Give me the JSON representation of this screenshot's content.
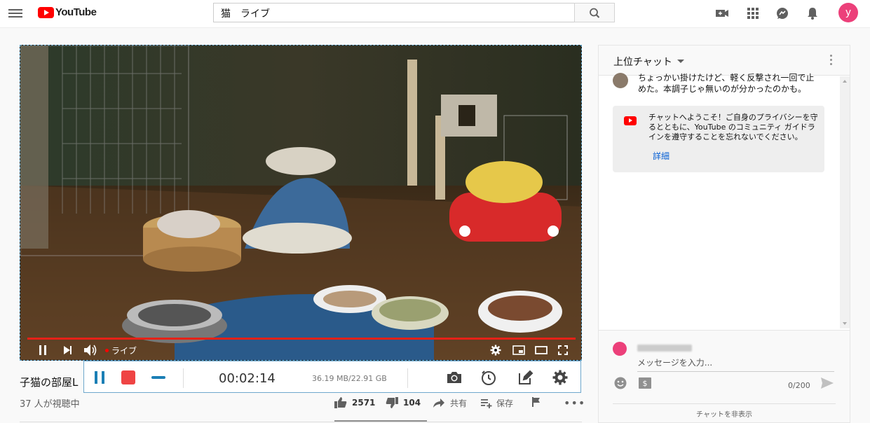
{
  "header": {
    "logo_text": "YouTube",
    "search_value": "猫　ライブ",
    "avatar_letter": "y"
  },
  "video": {
    "live_label": "ライブ"
  },
  "recorder": {
    "time": "00:02:14",
    "size": "36.19 MB/22.91 GB"
  },
  "info": {
    "title": "子猫の部屋L",
    "viewers": "37 人が視聴中",
    "likes": "2571",
    "dislikes": "104",
    "share": "共有",
    "save": "保存"
  },
  "chat": {
    "title": "上位チャット",
    "message": "ちょっかい掛けたけど、軽く反撃され一回で止めた。本調子じゃ無いのが分かったのかも。",
    "welcome_text": "チャットへようこそ！ご自身のプライバシーを守るとともに、YouTube のコミュニティ ガイドラインを遵守することを忘れないでください。",
    "welcome_link": "詳細",
    "input_placeholder": "メッセージを入力...",
    "char_count": "0/200",
    "hide_chat": "チャットを非表示"
  },
  "colors": {
    "brand_red": "#ff0000",
    "progress_red": "#e62117",
    "recorder_blue": "#1b7fb5",
    "record_red": "#ef4444",
    "avatar_pink": "#ec407a",
    "link_blue": "#065fd4"
  }
}
